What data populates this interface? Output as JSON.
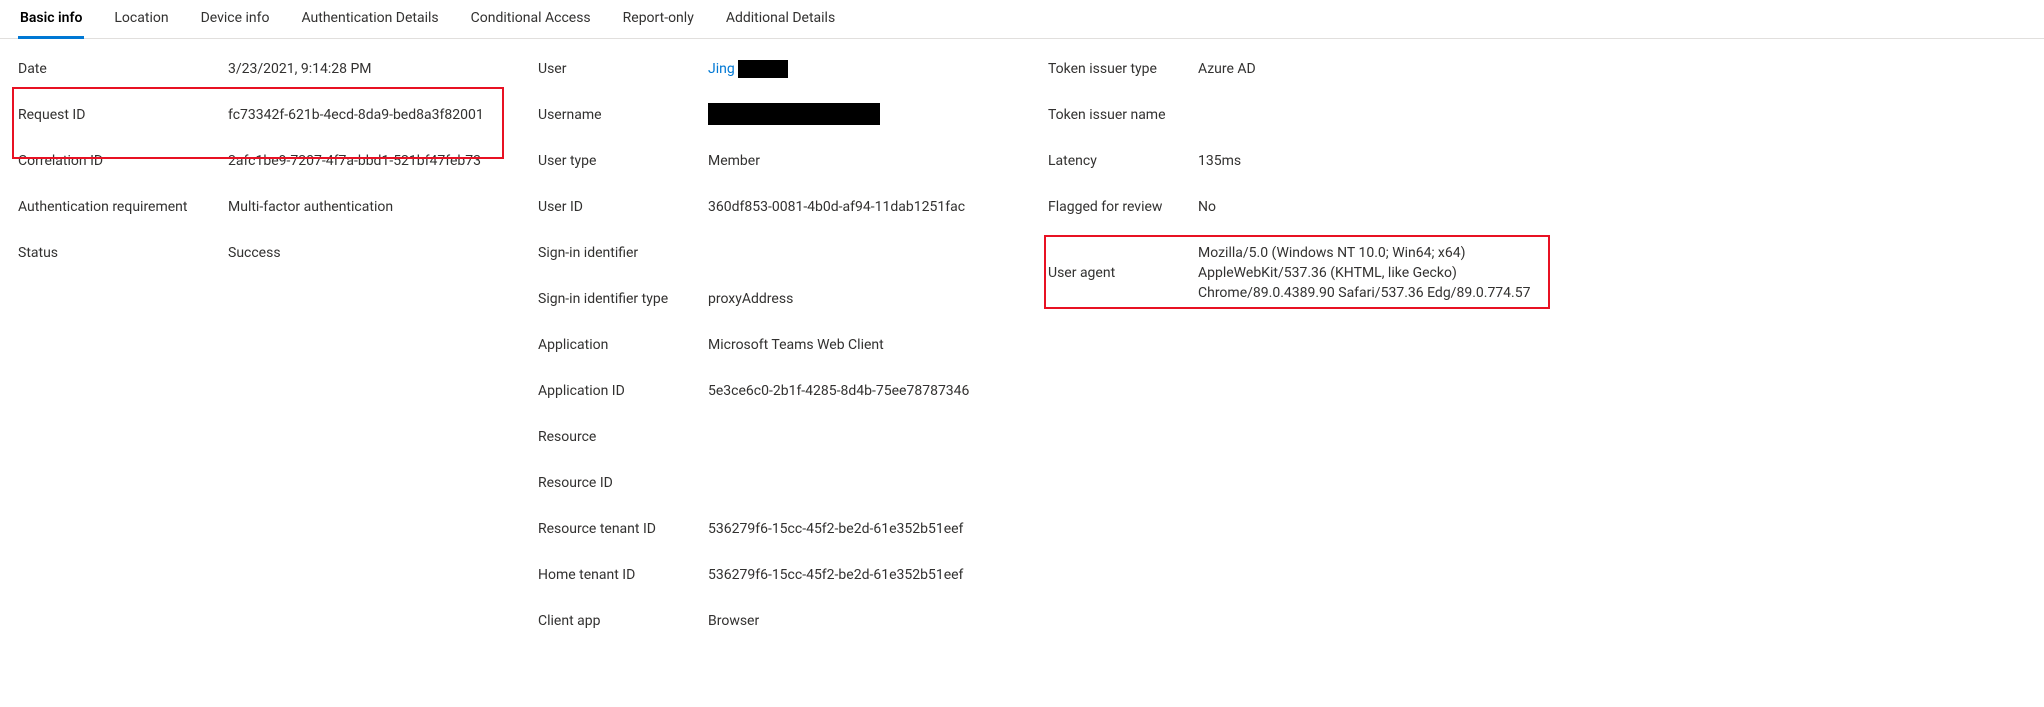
{
  "tabs": {
    "basic_info": "Basic info",
    "location": "Location",
    "device_info": "Device info",
    "authentication_details": "Authentication Details",
    "conditional_access": "Conditional Access",
    "report_only": "Report-only",
    "additional_details": "Additional Details"
  },
  "col1": {
    "date": {
      "label": "Date",
      "value": "3/23/2021, 9:14:28 PM"
    },
    "request_id": {
      "label": "Request ID",
      "value": "fc73342f-621b-4ecd-8da9-bed8a3f82001"
    },
    "correlation_id": {
      "label": "Correlation ID",
      "value": "2afc1be9-7207-4f7a-bbd1-521bf47feb73"
    },
    "auth_req": {
      "label": "Authentication requirement",
      "value": "Multi-factor authentication"
    },
    "status": {
      "label": "Status",
      "value": "Success"
    }
  },
  "col2": {
    "user": {
      "label": "User",
      "value": "Jing "
    },
    "username": {
      "label": "Username",
      "value": ""
    },
    "user_type": {
      "label": "User type",
      "value": "Member"
    },
    "user_id": {
      "label": "User ID",
      "value": "360df853-0081-4b0d-af94-11dab1251fac"
    },
    "signin_identifier": {
      "label": "Sign-in identifier",
      "value": ""
    },
    "signin_identifier_type": {
      "label": "Sign-in identifier type",
      "value": "proxyAddress"
    },
    "application": {
      "label": "Application",
      "value": "Microsoft Teams Web Client"
    },
    "application_id": {
      "label": "Application ID",
      "value": "5e3ce6c0-2b1f-4285-8d4b-75ee78787346"
    },
    "resource": {
      "label": "Resource",
      "value": ""
    },
    "resource_id": {
      "label": "Resource ID",
      "value": ""
    },
    "resource_tenant_id": {
      "label": "Resource tenant ID",
      "value": "536279f6-15cc-45f2-be2d-61e352b51eef"
    },
    "home_tenant_id": {
      "label": "Home tenant ID",
      "value": "536279f6-15cc-45f2-be2d-61e352b51eef"
    },
    "client_app": {
      "label": "Client app",
      "value": "Browser"
    }
  },
  "col3": {
    "token_issuer_type": {
      "label": "Token issuer type",
      "value": "Azure AD"
    },
    "token_issuer_name": {
      "label": "Token issuer name",
      "value": ""
    },
    "latency": {
      "label": "Latency",
      "value": "135ms"
    },
    "flagged": {
      "label": "Flagged for review",
      "value": "No"
    },
    "user_agent": {
      "label": "User agent",
      "value": "Mozilla/5.0 (Windows NT 10.0; Win64; x64) AppleWebKit/537.36 (KHTML, like Gecko) Chrome/89.0.4389.90 Safari/537.36 Edg/89.0.774.57"
    }
  }
}
